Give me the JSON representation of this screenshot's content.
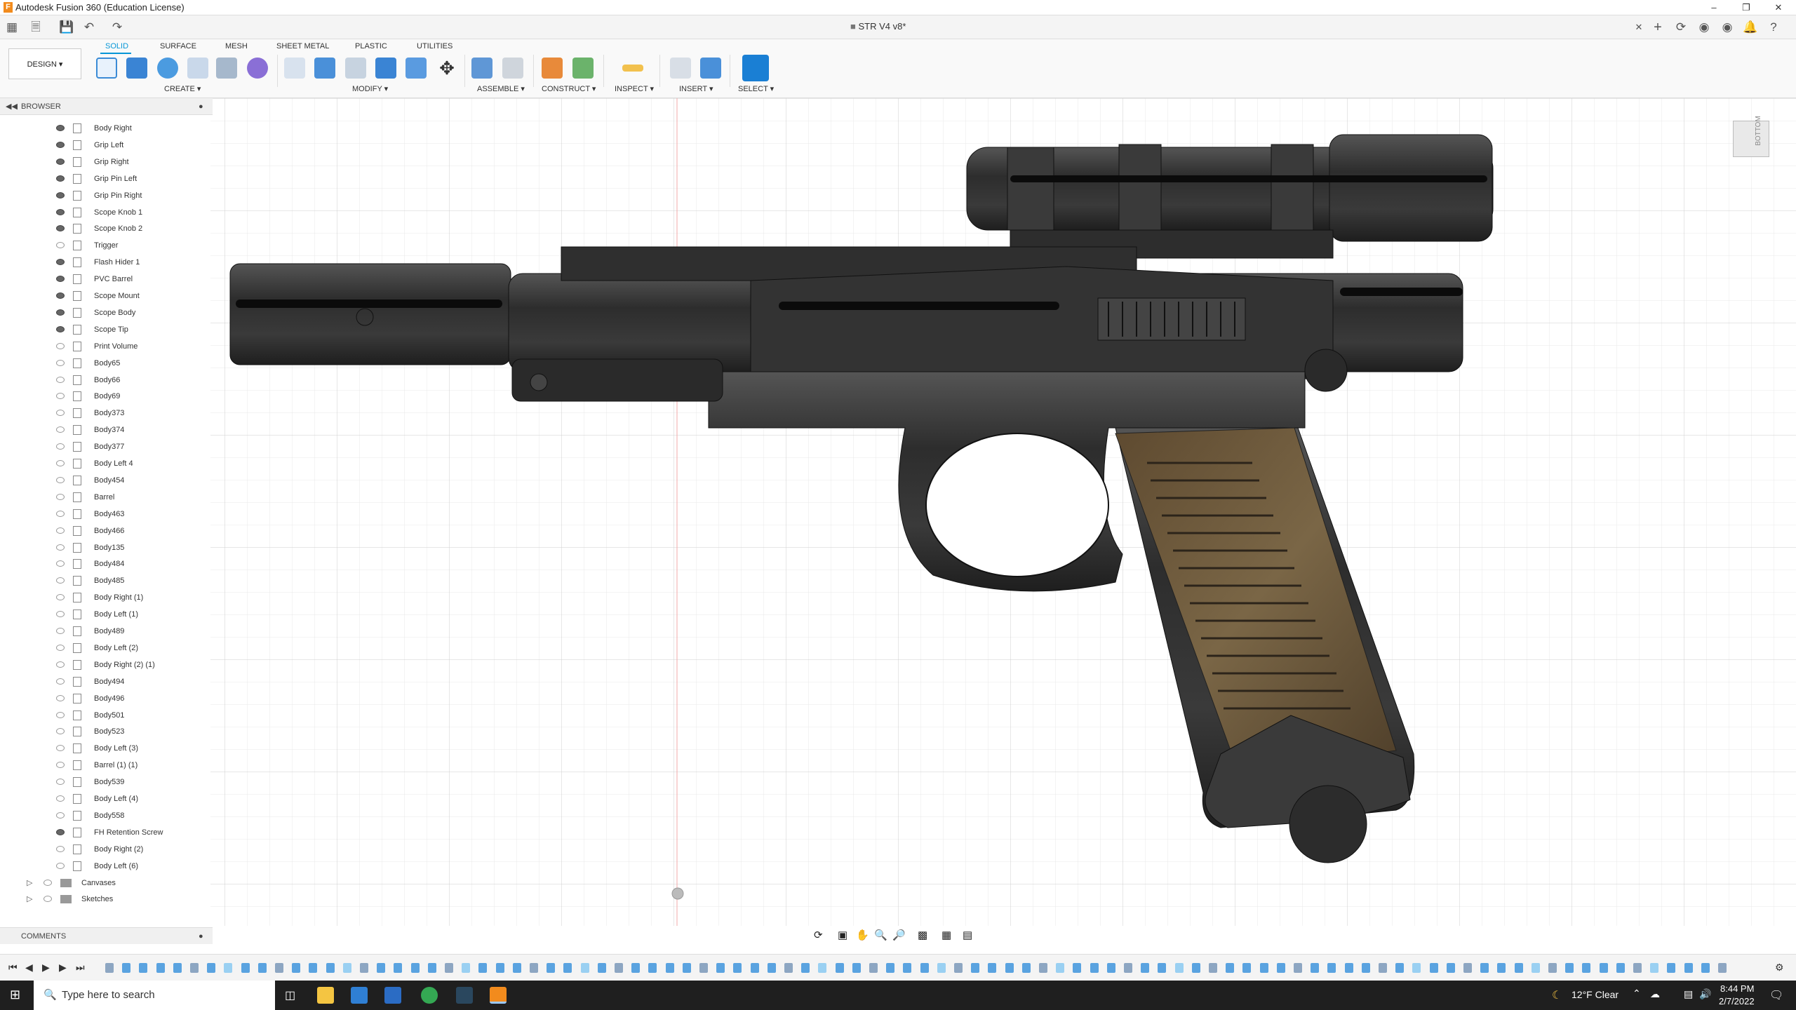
{
  "window": {
    "title": "Autodesk Fusion 360 (Education License)"
  },
  "document": {
    "tab_title": "STR V4 v8*"
  },
  "workspace": {
    "label": "DESIGN"
  },
  "ws_tabs": [
    "SOLID",
    "SURFACE",
    "MESH",
    "SHEET METAL",
    "PLASTIC",
    "UTILITIES"
  ],
  "groups": {
    "create": "CREATE",
    "modify": "MODIFY",
    "assemble": "ASSEMBLE",
    "construct": "CONSTRUCT",
    "inspect": "INSPECT",
    "insert": "INSERT",
    "select": "SELECT"
  },
  "browser": {
    "title": "BROWSER",
    "items": [
      {
        "label": "Body Right",
        "visible": true
      },
      {
        "label": "Grip Left",
        "visible": true
      },
      {
        "label": "Grip Right",
        "visible": true
      },
      {
        "label": "Grip Pin Left",
        "visible": true
      },
      {
        "label": "Grip Pin Right",
        "visible": true
      },
      {
        "label": "Scope Knob 1",
        "visible": true
      },
      {
        "label": "Scope Knob 2",
        "visible": true
      },
      {
        "label": "Trigger",
        "visible": false
      },
      {
        "label": "Flash Hider 1",
        "visible": true
      },
      {
        "label": "PVC Barrel",
        "visible": true
      },
      {
        "label": "Scope Mount",
        "visible": true
      },
      {
        "label": "Scope Body",
        "visible": true
      },
      {
        "label": "Scope Tip",
        "visible": true
      },
      {
        "label": "Print Volume",
        "visible": false
      },
      {
        "label": "Body65",
        "visible": false
      },
      {
        "label": "Body66",
        "visible": false
      },
      {
        "label": "Body69",
        "visible": false
      },
      {
        "label": "Body373",
        "visible": false
      },
      {
        "label": "Body374",
        "visible": false
      },
      {
        "label": "Body377",
        "visible": false
      },
      {
        "label": "Body Left 4",
        "visible": false
      },
      {
        "label": "Body454",
        "visible": false
      },
      {
        "label": "Barrel",
        "visible": false
      },
      {
        "label": "Body463",
        "visible": false
      },
      {
        "label": "Body466",
        "visible": false
      },
      {
        "label": "Body135",
        "visible": false
      },
      {
        "label": "Body484",
        "visible": false
      },
      {
        "label": "Body485",
        "visible": false
      },
      {
        "label": "Body Right (1)",
        "visible": false
      },
      {
        "label": "Body Left (1)",
        "visible": false
      },
      {
        "label": "Body489",
        "visible": false
      },
      {
        "label": "Body Left (2)",
        "visible": false
      },
      {
        "label": "Body Right (2) (1)",
        "visible": false
      },
      {
        "label": "Body494",
        "visible": false
      },
      {
        "label": "Body496",
        "visible": false
      },
      {
        "label": "Body501",
        "visible": false
      },
      {
        "label": "Body523",
        "visible": false
      },
      {
        "label": "Body Left (3)",
        "visible": false
      },
      {
        "label": "Barrel (1) (1)",
        "visible": false
      },
      {
        "label": "Body539",
        "visible": false
      },
      {
        "label": "Body Left (4)",
        "visible": false
      },
      {
        "label": "Body558",
        "visible": false
      },
      {
        "label": "FH Retention Screw",
        "visible": true
      },
      {
        "label": "Body Right (2)",
        "visible": false
      },
      {
        "label": "Body Left (6)",
        "visible": false
      }
    ],
    "folders": [
      "Canvases",
      "Sketches"
    ]
  },
  "comments": {
    "title": "COMMENTS"
  },
  "viewcube": {
    "label": "BOTTOM"
  },
  "taskbar": {
    "search_placeholder": "Type here to search",
    "weather": "12°F  Clear",
    "time": "8:44 PM",
    "date": "2/7/2022"
  }
}
